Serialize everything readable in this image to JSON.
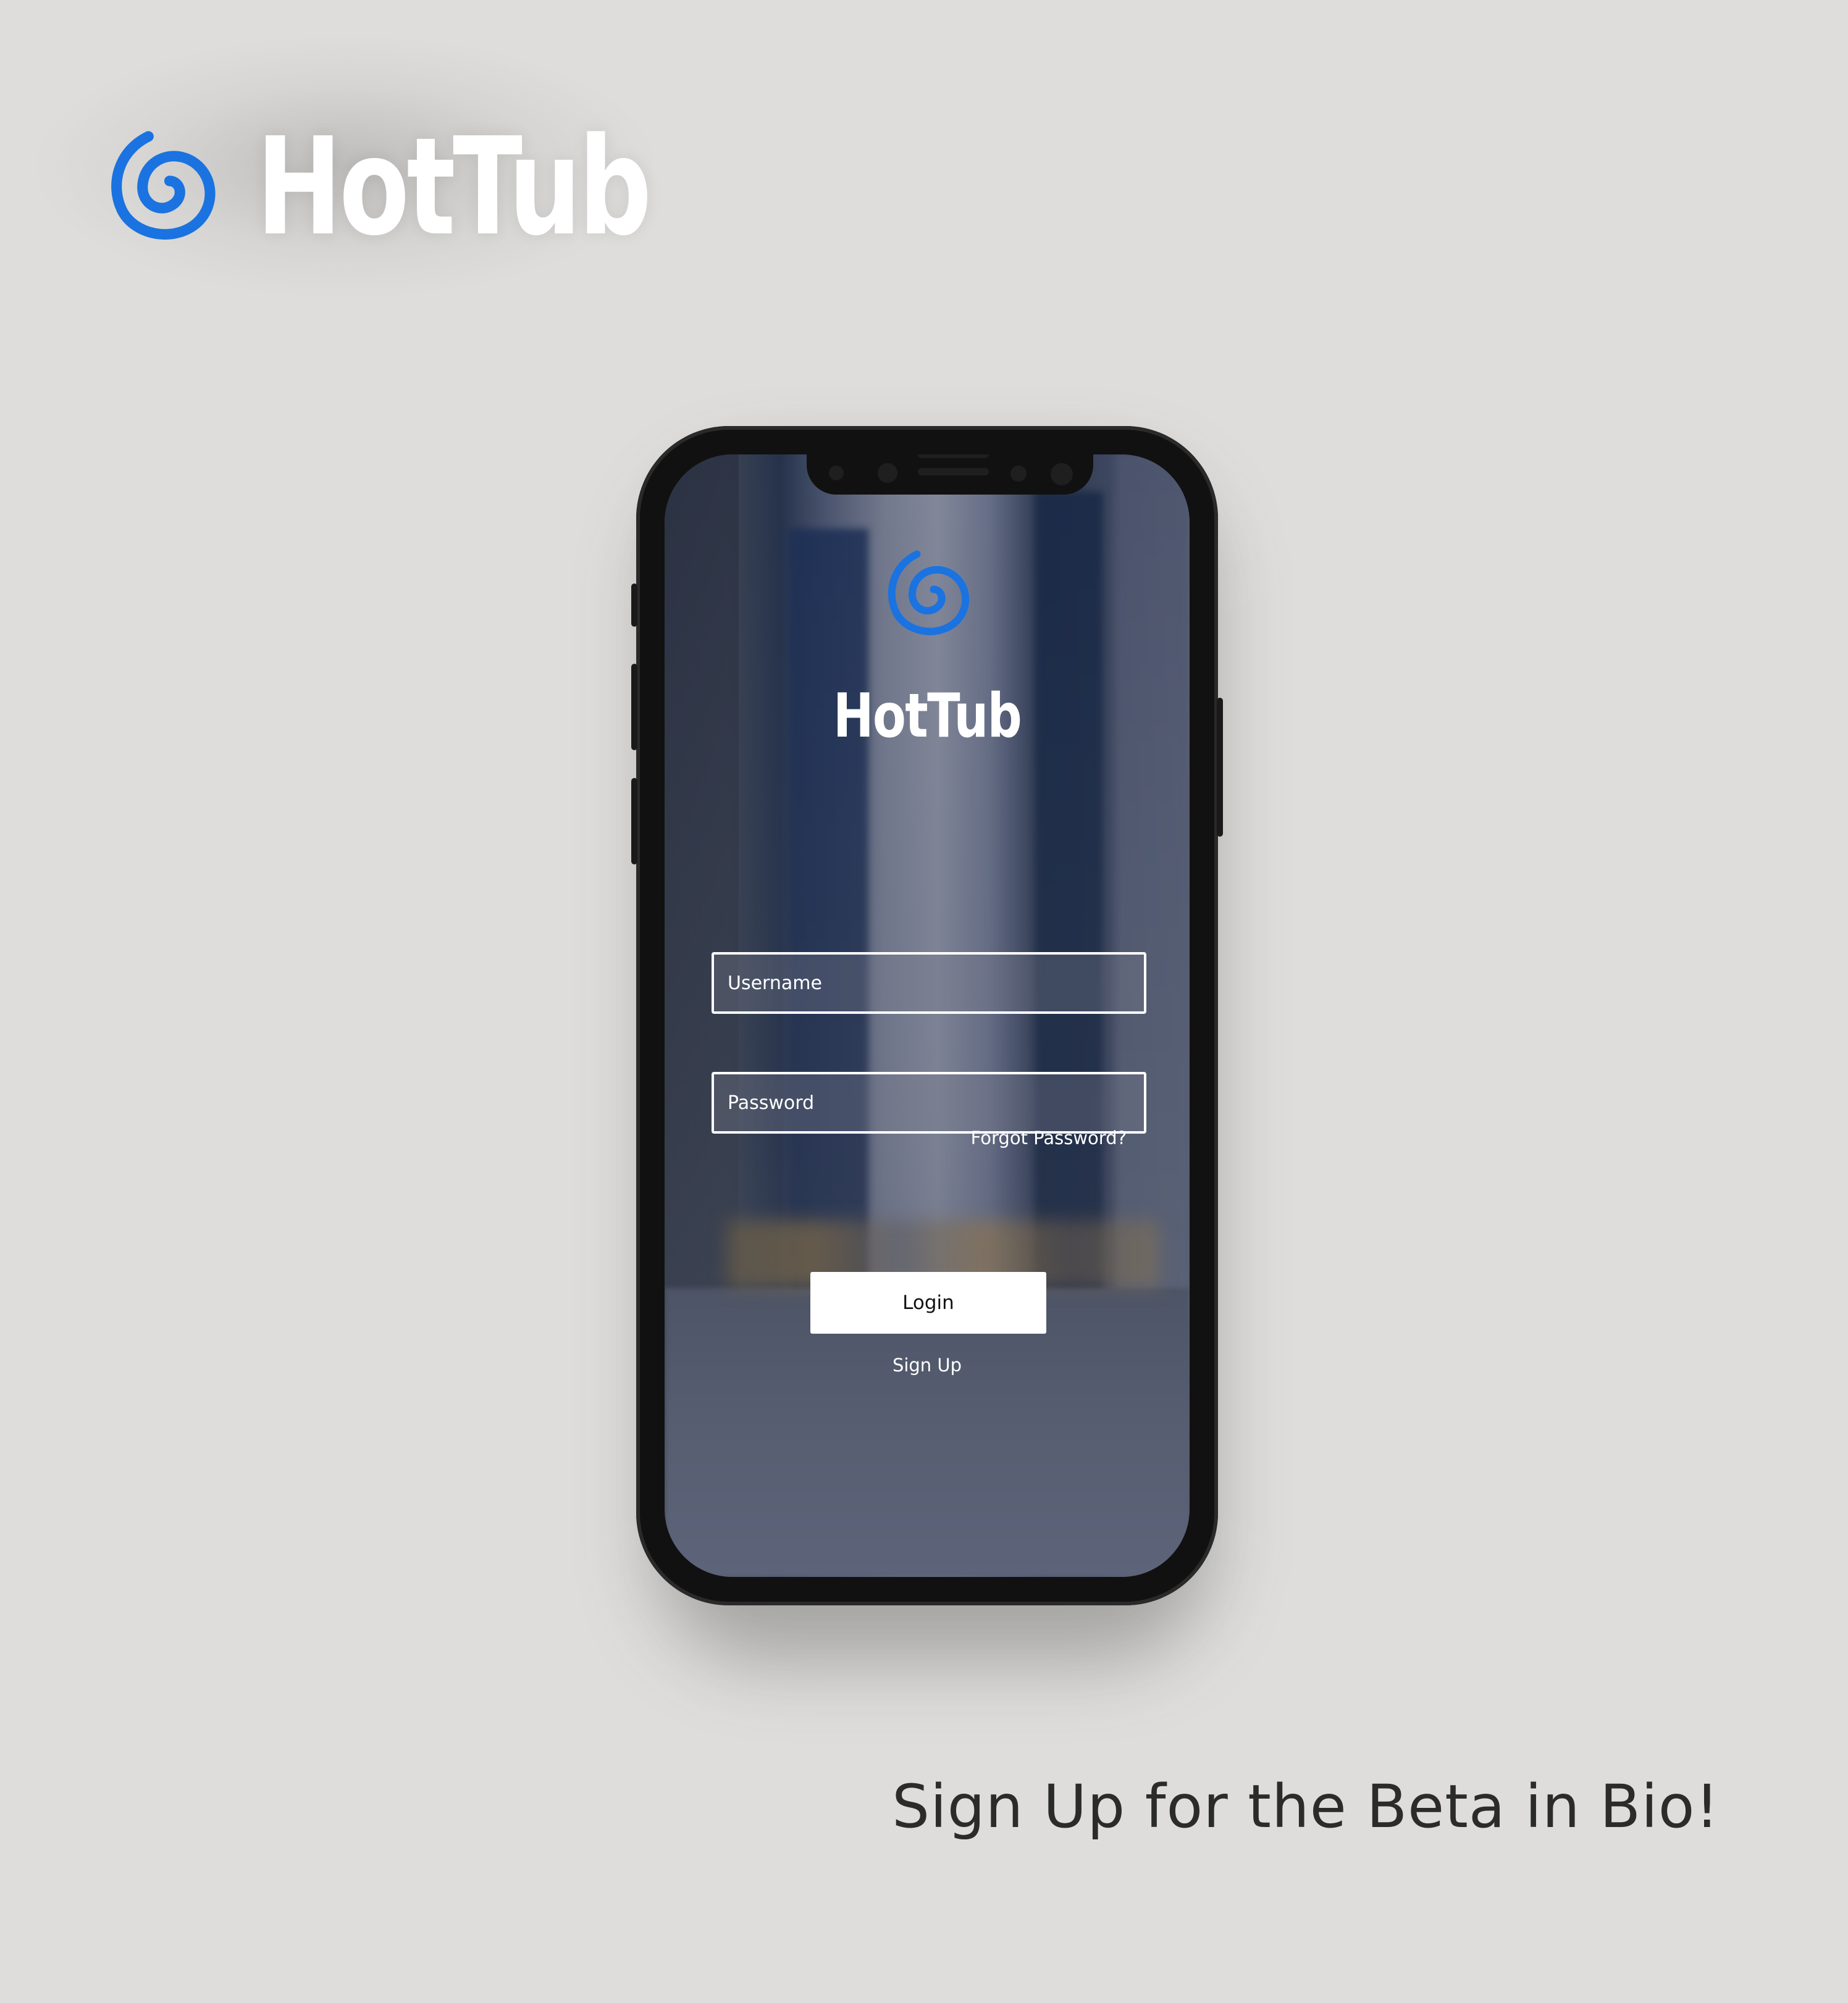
{
  "brand": {
    "name": "HotTub",
    "logo_icon": "swirl-icon",
    "logo_color": "#1a73e0"
  },
  "app": {
    "title": "HotTub",
    "logo_icon": "swirl-icon",
    "username_placeholder": "Username",
    "password_placeholder": "Password",
    "forgot_password": "Forgot Password?",
    "login_label": "Login",
    "signup_label": "Sign Up"
  },
  "tagline": "Sign Up for the Beta in Bio!",
  "colors": {
    "background": "#dedddb",
    "accent": "#1a73e0",
    "phone_frame": "#111111",
    "text_dark": "#2b2b2b",
    "text_light": "#ffffff"
  }
}
